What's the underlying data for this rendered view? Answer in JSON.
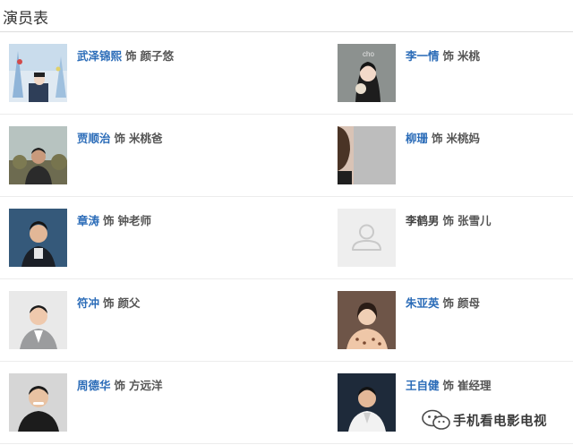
{
  "section": {
    "title": "演员表"
  },
  "cast": [
    {
      "actor": "武泽锦熙",
      "as": "饰",
      "role": "颜子悠",
      "linked": true,
      "photo": "photo-1"
    },
    {
      "actor": "李一情",
      "as": "饰",
      "role": "米桃",
      "linked": true,
      "photo": "photo-2"
    },
    {
      "actor": "贾顺治",
      "as": "饰",
      "role": "米桃爸",
      "linked": true,
      "photo": "photo-3"
    },
    {
      "actor": "柳珊",
      "as": "饰",
      "role": "米桃妈",
      "linked": true,
      "photo": "photo-4"
    },
    {
      "actor": "章涛",
      "as": "饰",
      "role": "钟老师",
      "linked": true,
      "photo": "photo-5"
    },
    {
      "actor": "李鹤男",
      "as": "饰",
      "role": "张雪儿",
      "linked": false,
      "photo": "avatar-placeholder-icon"
    },
    {
      "actor": "符冲",
      "as": "饰",
      "role": "颜父",
      "linked": true,
      "photo": "photo-7"
    },
    {
      "actor": "朱亚英",
      "as": "饰",
      "role": "颜母",
      "linked": true,
      "photo": "photo-8"
    },
    {
      "actor": "周德华",
      "as": "饰",
      "role": "方远洋",
      "linked": true,
      "photo": "photo-9"
    },
    {
      "actor": "王自健",
      "as": "饰",
      "role": "崔经理",
      "linked": true,
      "photo": "photo-10"
    }
  ],
  "watermark": {
    "text": "手机看电影电视",
    "icon": "wechat-icon"
  },
  "colors": {
    "link": "#2b6cb8",
    "text": "#555555",
    "divider": "#ececec"
  }
}
